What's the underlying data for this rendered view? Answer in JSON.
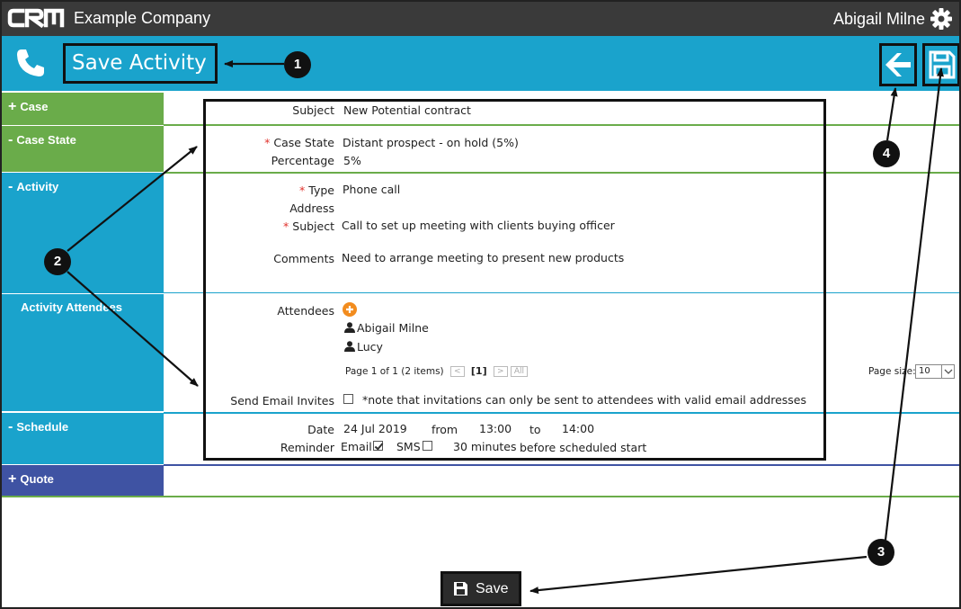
{
  "app": {
    "logo_text": "CRM",
    "company": "Example Company",
    "user": "Abigail Milne"
  },
  "header": {
    "title": "Save Activity"
  },
  "sections": {
    "case": "Case",
    "case_state": "Case State",
    "activity": "Activity",
    "attendees": "Activity Attendees",
    "schedule": "Schedule",
    "quote": "Quote",
    "expand_symbol": "+",
    "collapse_symbol": "-"
  },
  "form": {
    "subject_label": "Subject",
    "subject_value": "New Potential contract",
    "case_state_label": "Case State",
    "case_state_value": "Distant prospect - on hold (5%)",
    "percentage_label": "Percentage",
    "percentage_value": "5%",
    "type_label": "Type",
    "type_value": "Phone call",
    "address_label": "Address",
    "activity_subject_label": "Subject",
    "activity_subject_value": "Call to set up meeting with clients buying officer",
    "comments_label": "Comments",
    "comments_value": "Need to arrange meeting to present new products",
    "attendees_label": "Attendees",
    "attendees": [
      "Abigail Milne",
      "Lucy"
    ],
    "pager_text": "Page 1 of 1 (2 items)",
    "pager_prev": "<",
    "pager_current": "[1]",
    "pager_next": ">",
    "pager_all": "All",
    "page_size_label": "Page size:",
    "page_size_value": "10",
    "send_email_label": "Send Email Invites",
    "send_email_note": "*note that invitations can only be sent to attendees with valid email addresses",
    "date_label": "Date",
    "date_value": "24 Jul 2019",
    "from_label": "from",
    "from_value": "13:00",
    "to_label": "to",
    "to_value": "14:00",
    "reminder_label": "Reminder",
    "email_label": "Email",
    "email_checked": true,
    "sms_label": "SMS",
    "sms_checked": false,
    "minutes_value": "30 minutes",
    "before_text": "before scheduled start",
    "required_mark": "*"
  },
  "footer": {
    "save_label": "Save"
  },
  "callouts": [
    "1",
    "2",
    "3",
    "4"
  ],
  "colors": {
    "topbar": "#3a3a3a",
    "blue": "#1aa3cc",
    "green": "#6aac4a",
    "quote": "#3f53a3",
    "orange": "#f28c1e",
    "required": "#e0312b"
  }
}
